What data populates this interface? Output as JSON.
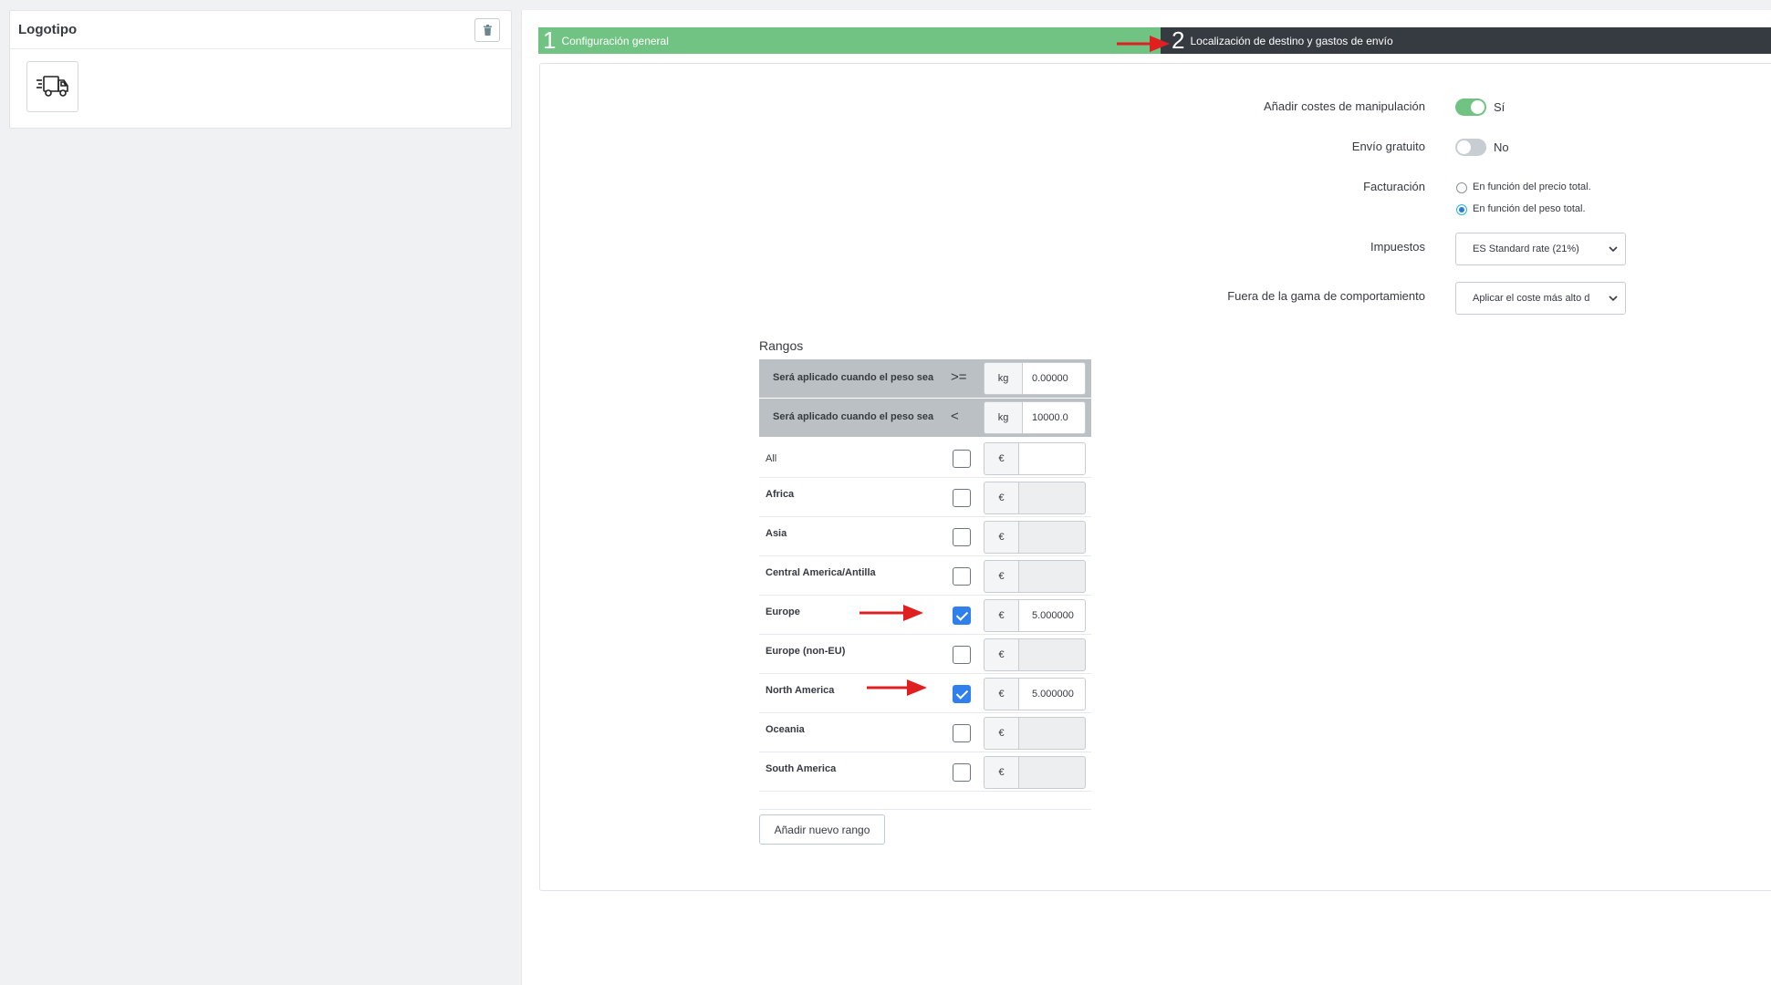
{
  "logo_card": {
    "title": "Logotipo",
    "delete_icon": "trash-icon",
    "image_icon": "delivery-truck-icon"
  },
  "steps": [
    {
      "number": "1",
      "label": "Configuración general",
      "color": "#70c383"
    },
    {
      "number": "2",
      "label": "Localización de destino y gastos de envío",
      "color": "#363a41"
    }
  ],
  "form": {
    "handling_costs": {
      "label": "Añadir costes de manipulación",
      "value": "Sí",
      "enabled": true
    },
    "free_shipping": {
      "label": "Envío gratuito",
      "value": "No",
      "enabled": false
    },
    "billing": {
      "label": "Facturación",
      "options": [
        {
          "label": "En función del precio total.",
          "selected": false
        },
        {
          "label": "En función del peso total.",
          "selected": true
        }
      ]
    },
    "taxes": {
      "label": "Impuestos",
      "selected": "ES Standard rate (21%)"
    },
    "out_of_range": {
      "label": "Fuera de la gama de comportamiento",
      "selected": "Aplicar el coste más alto d"
    }
  },
  "ranges": {
    "title": "Rangos",
    "lower": {
      "label": "Será aplicado cuando el peso sea",
      "operator": ">=",
      "unit": "kg",
      "value": "0.00000"
    },
    "upper": {
      "label": "Será aplicado cuando el peso sea",
      "operator": "<",
      "unit": "kg",
      "value": "10000.0"
    },
    "currency": "€",
    "zones": [
      {
        "name": "All",
        "checked": false,
        "value": "",
        "disabled": false
      },
      {
        "name": "Africa",
        "checked": false,
        "value": "",
        "disabled": true
      },
      {
        "name": "Asia",
        "checked": false,
        "value": "",
        "disabled": true
      },
      {
        "name": "Central America/Antilla",
        "checked": false,
        "value": "",
        "disabled": true
      },
      {
        "name": "Europe",
        "checked": true,
        "value": "5.000000",
        "disabled": false
      },
      {
        "name": "Europe (non-EU)",
        "checked": false,
        "value": "",
        "disabled": true
      },
      {
        "name": "North America",
        "checked": true,
        "value": "5.000000",
        "disabled": false
      },
      {
        "name": "Oceania",
        "checked": false,
        "value": "",
        "disabled": true
      },
      {
        "name": "South America",
        "checked": false,
        "value": "",
        "disabled": true
      }
    ],
    "add_button": "Añadir nuevo rango"
  },
  "colors": {
    "accent_green": "#70c383",
    "dark_step": "#363a41",
    "checkbox_blue": "#2f80ed",
    "annotation_red": "#e02020"
  }
}
